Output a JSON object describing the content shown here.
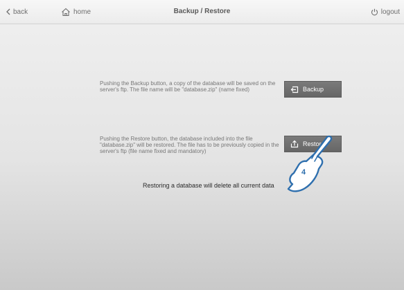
{
  "header": {
    "back_label": "back",
    "home_label": "home",
    "title": "Backup / Restore",
    "logout_label": "logout"
  },
  "backup": {
    "description": "Pushing the Backup button, a copy of the database will be saved on the server's ftp. The file name will be \"database.zip\" (name fixed)",
    "button_label": "Backup",
    "icon": "backup-icon"
  },
  "restore": {
    "description": "Pushing the Restore button, the database included into the file \"database.zip\" will be restored. The file has to be previously copied in the server's ftp (file name fixed and mandatory)",
    "button_label": "Restore",
    "icon": "restore-icon"
  },
  "warning": "Restoring a database will delete all current data",
  "annotation": {
    "step_number": "4",
    "icon": "pointing-hand-icon",
    "color": "#2e6fae"
  }
}
